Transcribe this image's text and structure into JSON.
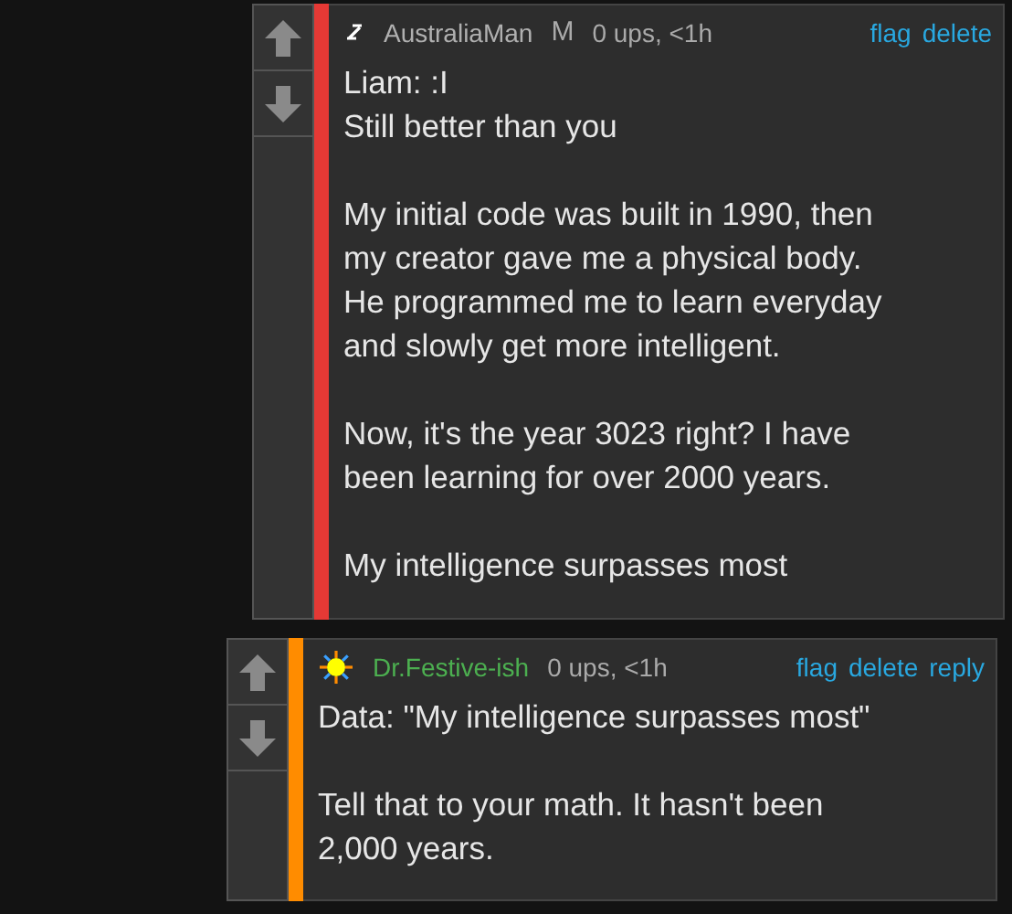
{
  "comments": [
    {
      "author": {
        "kind": "bolt",
        "name": "AustraliaMan",
        "color": "#b0b0b0"
      },
      "mod_badge": "M",
      "stats": "0 ups, <1h",
      "color": "#e53935",
      "actions": [
        "flag",
        "delete"
      ],
      "body": "Liam: :I\nStill better than you\n\nMy initial code was built in 1990, then\nmy creator gave me a physical body.\nHe programmed me to learn everyday\nand slowly get more intelligent.\n\nNow, it's the year 3023 right? I have\nbeen learning for over 2000 years.\n\nMy intelligence surpasses most"
    },
    {
      "author": {
        "kind": "sun",
        "name": "Dr.Festive-ish",
        "color": "#4caf50"
      },
      "stats": "0 ups, <1h",
      "color": "#ff8c00",
      "actions": [
        "flag",
        "delete",
        "reply"
      ],
      "body": "Data: \"My intelligence surpasses most\"\n\nTell that to your math. It hasn't been\n2,000 years."
    }
  ]
}
